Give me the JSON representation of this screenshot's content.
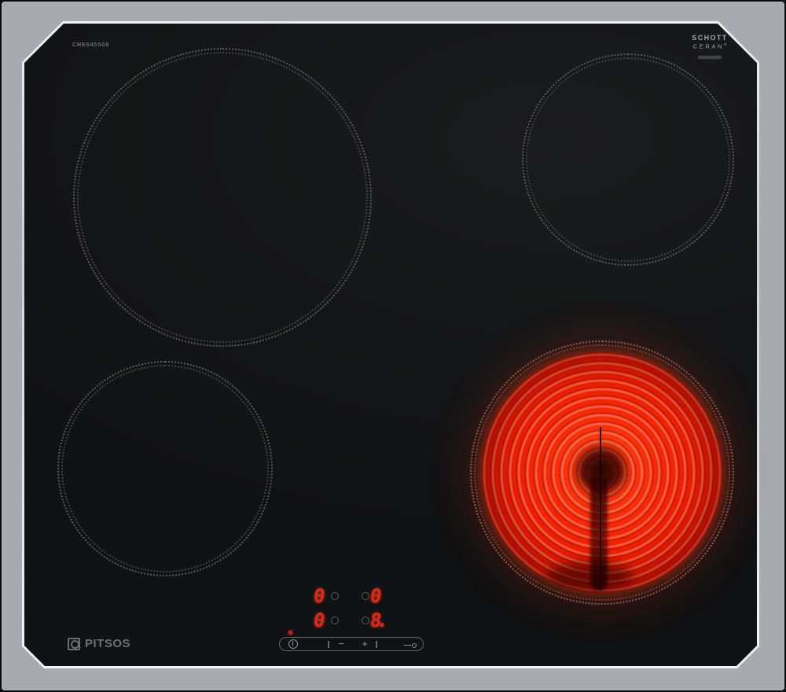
{
  "branding": {
    "model_number": "CRE645S06",
    "glass_logo": {
      "line1": "SCHOTT",
      "line2": "CERAN",
      "reg": "®"
    },
    "maker_wordmark": "PITSOS"
  },
  "control_panel": {
    "displays": {
      "values": [
        "0",
        "0",
        "0",
        "8."
      ]
    },
    "keys": {
      "minus": "−",
      "plus": "+"
    },
    "icons": [
      "power-icon",
      "child-lock-key-icon"
    ],
    "power_indicator_on": true
  },
  "zones": {
    "rear_left": {
      "state": "off"
    },
    "rear_right": {
      "state": "off"
    },
    "front_left": {
      "state": "off"
    },
    "front_right": {
      "state": "on",
      "level": "8"
    }
  },
  "colors": {
    "steel_frame": "#b0b4b8",
    "ceramic_glass": "#151617",
    "element_glow": "#ee1c03",
    "digit_red": "#d8281a",
    "zone_marking_gray": "#585858"
  }
}
